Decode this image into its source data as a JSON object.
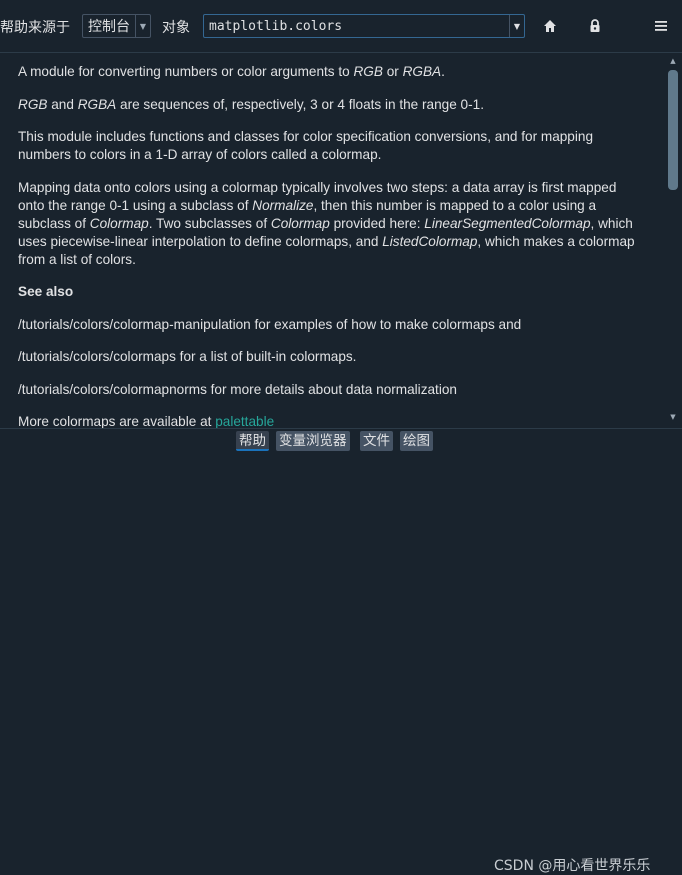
{
  "toolbar": {
    "source_label": "帮助来源于",
    "source_value": "控制台",
    "object_label": "对象",
    "object_value": "matplotlib.colors",
    "home_icon": "home-icon",
    "lock_icon": "lock-icon",
    "menu_icon": "hamburger-menu-icon"
  },
  "doc": {
    "p1_a": "A module for converting numbers or color arguments to ",
    "p1_rgb": "RGB",
    "p1_or": " or ",
    "p1_rgba": "RGBA",
    "p1_end": ".",
    "p2_rgb": "RGB",
    "p2_and": " and ",
    "p2_rgba": "RGBA",
    "p2_rest": " are sequences of, respectively, 3 or 4 floats in the range 0-1.",
    "p3": "This module includes functions and classes for color specification conversions, and for mapping numbers to colors in a 1-D array of colors called a colormap.",
    "p4_a": "Mapping data onto colors using a colormap typically involves two steps: a data array is first mapped onto the range 0-1 using a subclass of ",
    "p4_normalize": "Normalize",
    "p4_b": ", then this number is mapped to a color using a subclass of ",
    "p4_colormap": "Colormap",
    "p4_c": ". Two subclasses of ",
    "p4_colormap2": "Colormap",
    "p4_d": " provided here: ",
    "p4_lsc": "LinearSegmentedColormap",
    "p4_e": ", which uses piecewise-linear interpolation to define colormaps, and ",
    "p4_lc": "ListedColormap",
    "p4_f": ", which makes a colormap from a list of colors.",
    "see_also": "See also",
    "p5": "/tutorials/colors/colormap-manipulation for examples of how to make colormaps and",
    "p6": "/tutorials/colors/colormaps for a list of built-in colormaps.",
    "p7": "/tutorials/colors/colormapnorms for more details about data normalization",
    "p8_a": "More colormaps are available at ",
    "p8_link": "palettable"
  },
  "tabs": [
    "帮助",
    "变量浏览器",
    "文件",
    "绘图"
  ],
  "watermark": "CSDN @用心看世界乐乐",
  "colors": {
    "background": "#19232d",
    "text": "#e0e1e3",
    "link": "#26a69a",
    "border": "#455364",
    "focus_border": "#346792"
  }
}
